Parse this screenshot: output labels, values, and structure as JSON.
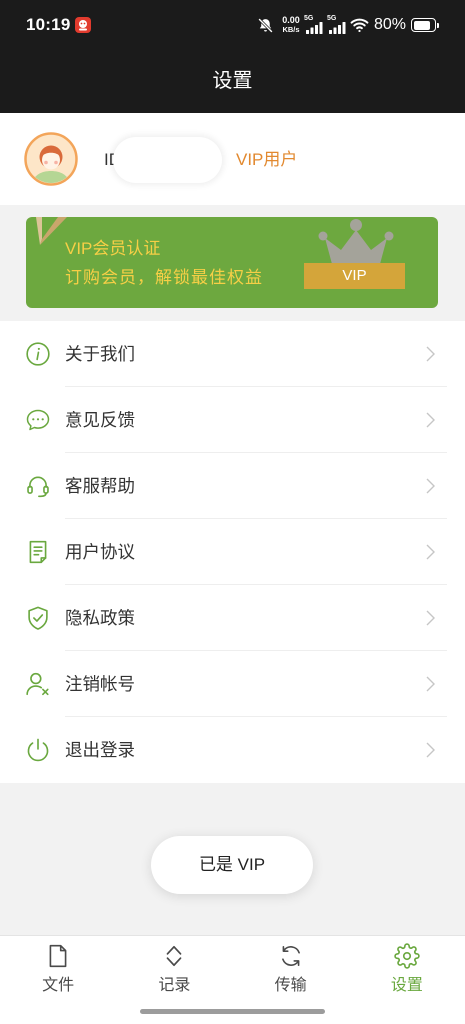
{
  "status_bar": {
    "time": "10:19",
    "net_speed_value": "0.00",
    "net_speed_unit": "KB/s",
    "sim1_network": "5G",
    "sim2_network": "5G",
    "battery_text": "80%",
    "battery_level": 0.8,
    "app_icon": "app-notification-icon",
    "mute_icon": "bell-mute-icon",
    "wifi_icon": "wifi-icon"
  },
  "header": {
    "title": "设置"
  },
  "profile": {
    "id_label": "ID",
    "membership_label": "VIP用户",
    "avatar_icon": "girl-avatar"
  },
  "vip_card": {
    "title": "VIP会员认证",
    "subtitle": "订购会员，解锁最佳权益",
    "badge": "VIP",
    "icon": "crown-icon"
  },
  "menu": [
    {
      "label": "关于我们",
      "icon": "info-icon"
    },
    {
      "label": "意见反馈",
      "icon": "chat-bubble-icon"
    },
    {
      "label": "客服帮助",
      "icon": "headset-icon"
    },
    {
      "label": "用户协议",
      "icon": "document-icon"
    },
    {
      "label": "隐私政策",
      "icon": "shield-check-icon"
    },
    {
      "label": "注销帐号",
      "icon": "user-remove-icon"
    },
    {
      "label": "退出登录",
      "icon": "power-icon"
    }
  ],
  "toast": {
    "text": "已是 VIP"
  },
  "tabs": [
    {
      "label": "文件",
      "icon": "file-icon",
      "active": false
    },
    {
      "label": "记录",
      "icon": "sort-arrows-icon",
      "active": false
    },
    {
      "label": "传输",
      "icon": "sync-icon",
      "active": false
    },
    {
      "label": "设置",
      "icon": "gear-icon",
      "active": true
    }
  ],
  "colors": {
    "brand_green": "#6da83f",
    "icon_green": "#6aa83f",
    "vip_orange": "#e2892f",
    "card_text": "#f6cf46",
    "vip_badge": "#d4a53a",
    "crown_gray": "#a4a39a",
    "bar_dark": "#1b1b1b",
    "page_gray": "#f2f2f2"
  }
}
